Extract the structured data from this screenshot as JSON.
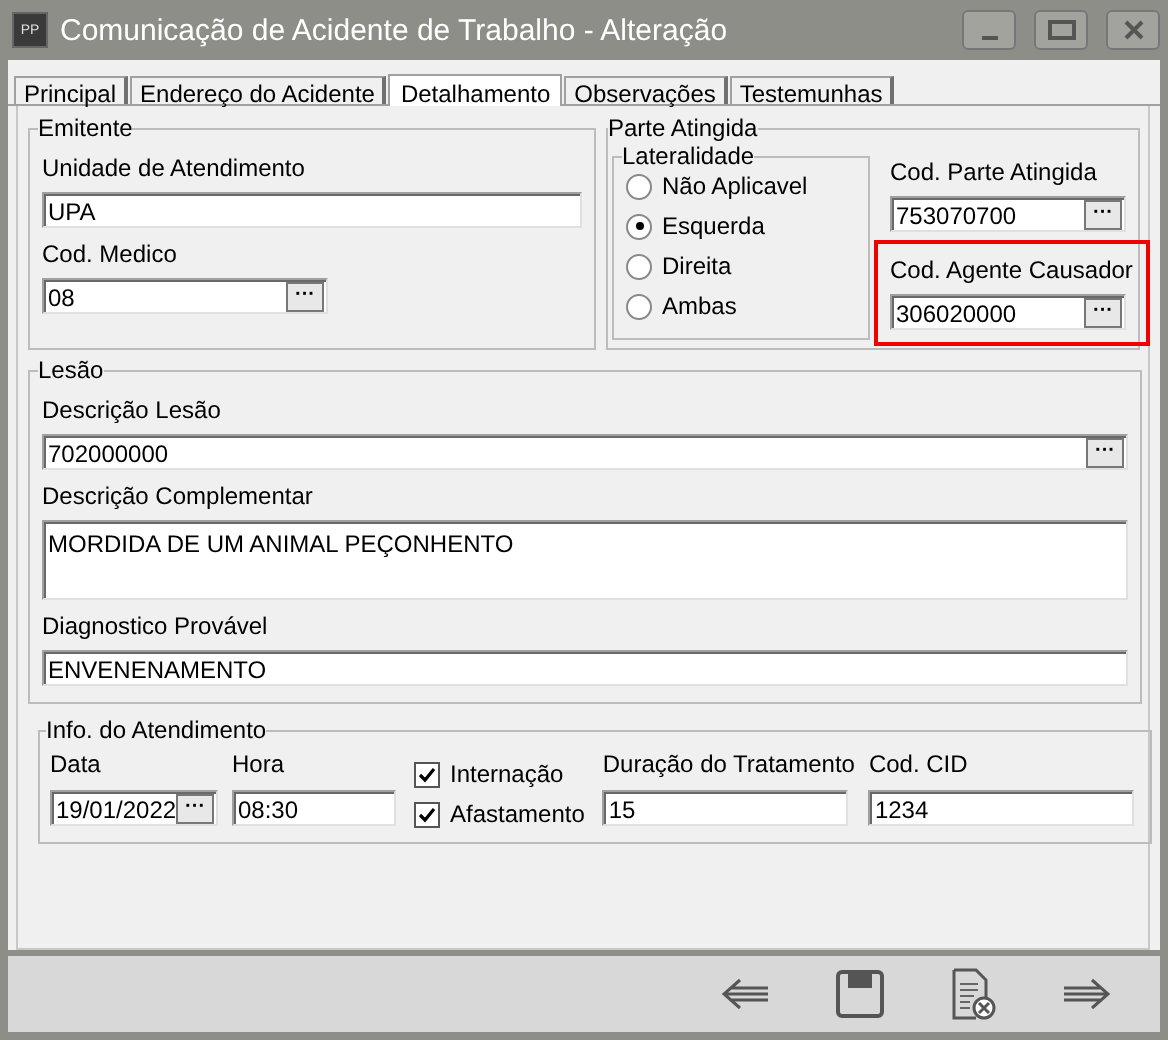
{
  "window": {
    "title": "Comunicação de Acidente de Trabalho - Alteração",
    "app_icon": "PP"
  },
  "tabs": [
    {
      "label": "Principal",
      "selected": false
    },
    {
      "label": "Endereço do Acidente",
      "selected": false
    },
    {
      "label": "Detalhamento",
      "selected": true
    },
    {
      "label": "Observações",
      "selected": false
    },
    {
      "label": "Testemunhas",
      "selected": false
    }
  ],
  "emitente": {
    "title": "Emitente",
    "fields": [
      {
        "label": "Unidade de Atendimento",
        "value": "UPA"
      },
      {
        "label": "Cod. Medico",
        "value": "08",
        "lookup": "···"
      }
    ]
  },
  "parte_atingida": {
    "title": "Parte Atingida",
    "lateralidade": {
      "title": "Lateralidade",
      "options": [
        {
          "label": "Não Aplicavel",
          "selected": false
        },
        {
          "label": "Esquerda",
          "selected": true
        },
        {
          "label": "Direita",
          "selected": false
        },
        {
          "label": "Ambas",
          "selected": false
        }
      ]
    },
    "fields": [
      {
        "label": "Cod. Parte Atingida",
        "value": "753070700",
        "lookup": "···",
        "highlighted": false
      },
      {
        "label": "Cod. Agente Causador",
        "value": "306020000",
        "lookup": "···",
        "highlighted": true
      }
    ]
  },
  "lesao": {
    "title": "Lesão",
    "fields": [
      {
        "kind": "line",
        "label": "Descrição Lesão",
        "value": "702000000",
        "lookup": "···"
      },
      {
        "kind": "memo",
        "label": "Descrição Complementar",
        "value": "MORDIDA DE UM ANIMAL PEÇONHENTO"
      },
      {
        "kind": "line",
        "label": "Diagnostico Provável",
        "value": "ENVENENAMENTO"
      }
    ]
  },
  "info_atendimento": {
    "title": "Info. do Atendimento",
    "items": [
      {
        "kind": "field",
        "label": "Data",
        "value": "19/01/2022",
        "lookup": "···"
      },
      {
        "kind": "field",
        "label": "Hora",
        "value": "08:30"
      },
      {
        "kind": "checks",
        "checks": [
          {
            "label": "Internação",
            "checked": true
          },
          {
            "label": "Afastamento",
            "checked": true
          }
        ]
      },
      {
        "kind": "field",
        "label": "Duração do Tratamento",
        "value": "15"
      },
      {
        "kind": "field",
        "label": "Cod. CID",
        "value": "1234"
      }
    ]
  }
}
